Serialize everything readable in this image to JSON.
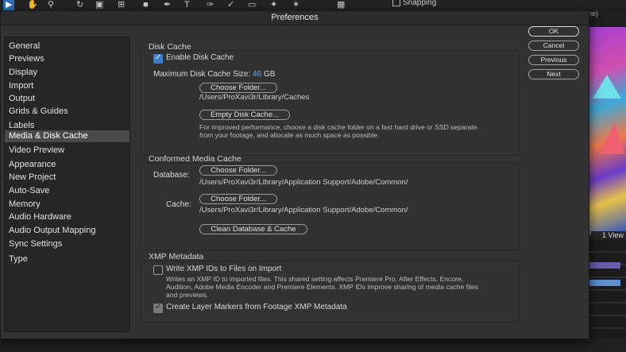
{
  "background": {
    "snapping_label": "Snapping",
    "view_label": "1 View",
    "right_top_fragment": "ne)"
  },
  "dialog": {
    "title": "Preferences",
    "buttons": {
      "ok": "OK",
      "cancel": "Cancel",
      "previous": "Previous",
      "next": "Next"
    }
  },
  "sidebar": {
    "items": [
      {
        "label": "General"
      },
      {
        "label": "Previews"
      },
      {
        "label": "Display"
      },
      {
        "label": "Import"
      },
      {
        "label": "Output"
      },
      {
        "label": "Grids & Guides"
      },
      {
        "label": "Labels"
      },
      {
        "label": "Media & Disk Cache",
        "selected": true
      },
      {
        "label": "Video Preview"
      },
      {
        "label": "Appearance"
      },
      {
        "label": "New Project"
      },
      {
        "label": "Auto-Save"
      },
      {
        "label": "Memory"
      },
      {
        "label": "Audio Hardware"
      },
      {
        "label": "Audio Output Mapping"
      },
      {
        "label": "Sync Settings"
      },
      {
        "label": "Type"
      }
    ]
  },
  "disk_cache": {
    "title": "Disk Cache",
    "enable_label": "Enable Disk Cache",
    "enable_checked": true,
    "max_size_label": "Maximum Disk Cache Size:",
    "max_size_value": "46",
    "max_size_unit": "GB",
    "choose_folder": "Choose Folder...",
    "path": "/Users/ProXavi3r/Library/Caches",
    "empty_button": "Empty Disk Cache...",
    "hint_line1": "For improved performance, choose a disk cache folder on a fast hard drive or SSD separate",
    "hint_line2": "from your footage, and allocate as much space as possible."
  },
  "conformed": {
    "title": "Conformed Media Cache",
    "database_label": "Database:",
    "database_button": "Choose Folder...",
    "database_path": "/Users/ProXavi3r/Library/Application Support/Adobe/Common/",
    "cache_label": "Cache:",
    "cache_button": "Choose Folder...",
    "cache_path": "/Users/ProXavi3r/Library/Application Support/Adobe/Common/",
    "clean_button": "Clean Database & Cache"
  },
  "xmp": {
    "title": "XMP Metadata",
    "write_label": "Write XMP IDs to Files on Import",
    "write_checked": false,
    "hint_line1": "Writes an XMP ID to imported files. This shared setting affects Premiere Pro, After Effects, Encore,",
    "hint_line2": "Audition, Adobe Media Encoder and Premiere Elements. XMP IDs improve sharing of media cache files",
    "hint_line3": "and previews.",
    "markers_label": "Create Layer Markers from Footage XMP Metadata",
    "markers_checked": true
  }
}
